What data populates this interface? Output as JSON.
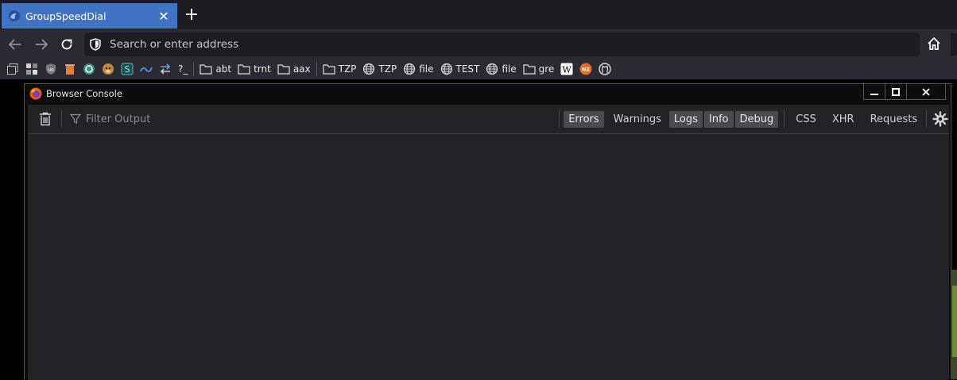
{
  "tab": {
    "title": "GroupSpeedDial",
    "favicon": "cloud-icon",
    "accent": "#4272c4"
  },
  "navbar": {
    "url_placeholder": "Search or enter address"
  },
  "bookmarks": [
    {
      "icon": "collections-icon",
      "label": ""
    },
    {
      "icon": "grid-icon",
      "label": ""
    },
    {
      "icon": "ublock-icon",
      "label": ""
    },
    {
      "icon": "trash-icon",
      "label": ""
    },
    {
      "icon": "refresh-circle-icon",
      "label": ""
    },
    {
      "icon": "monkey-icon",
      "label": ""
    },
    {
      "icon": "s-icon",
      "label": ""
    },
    {
      "icon": "wave-icon",
      "label": ""
    },
    {
      "icon": "arrows-icon",
      "label": ""
    },
    {
      "icon": "text-icon",
      "label": "?_"
    },
    {
      "icon": "folder-icon",
      "label": "abt"
    },
    {
      "icon": "folder-icon",
      "label": "trnt"
    },
    {
      "icon": "folder-icon",
      "label": "aax"
    },
    {
      "icon": "folder-icon",
      "label": "TZP"
    },
    {
      "icon": "globe-icon",
      "label": "TZP"
    },
    {
      "icon": "globe-icon",
      "label": "file"
    },
    {
      "icon": "globe-icon",
      "label": "TEST"
    },
    {
      "icon": "globe-icon",
      "label": "file"
    },
    {
      "icon": "folder-icon",
      "label": "gre"
    },
    {
      "icon": "wikipedia-icon",
      "label": ""
    },
    {
      "icon": "nz-icon",
      "label": ""
    },
    {
      "icon": "github-icon",
      "label": ""
    }
  ],
  "console": {
    "title": "Browser Console",
    "filter_placeholder": "Filter Output",
    "levels": [
      {
        "label": "Errors",
        "active": true
      },
      {
        "label": "Warnings",
        "active": false
      },
      {
        "label": "Logs",
        "active": true
      },
      {
        "label": "Info",
        "active": true
      },
      {
        "label": "Debug",
        "active": true
      }
    ],
    "types": [
      "CSS",
      "XHR",
      "Requests"
    ]
  }
}
